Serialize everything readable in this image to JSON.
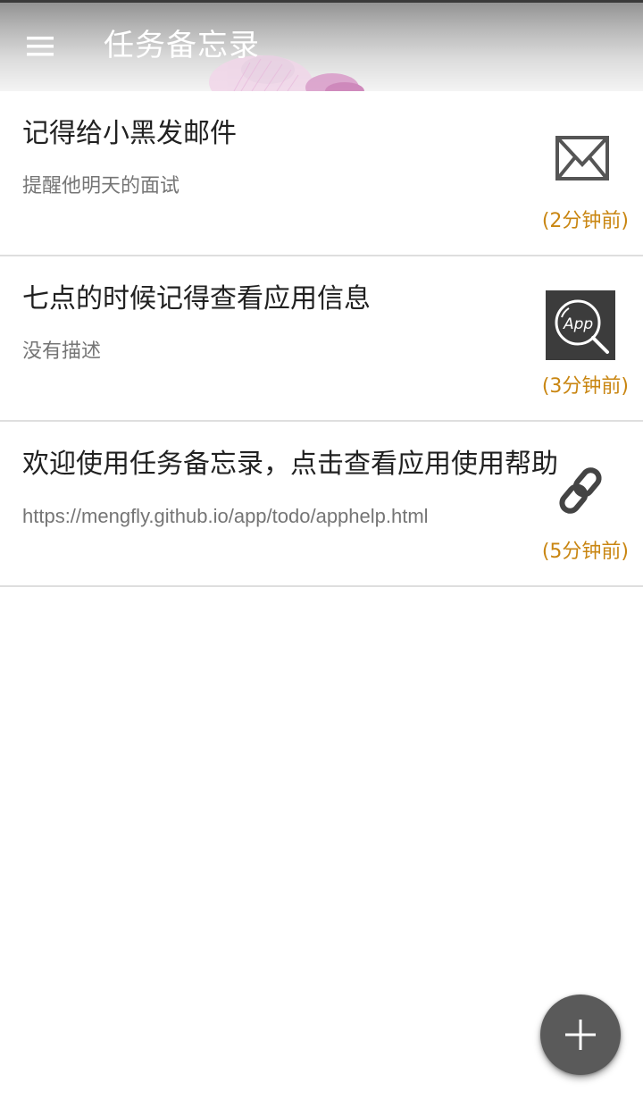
{
  "toolbar": {
    "title": "任务备忘录",
    "menu_icon": "menu-icon"
  },
  "tasks": [
    {
      "title": "记得给小黑发邮件",
      "description": "提醒他明天的面试",
      "time": "(2分钟前)",
      "icon": "mail-icon"
    },
    {
      "title": "七点的时候记得查看应用信息",
      "description": "没有描述",
      "time": "(3分钟前)",
      "icon": "app-search-icon",
      "icon_text": "App"
    },
    {
      "title": "欢迎使用任务备忘录，点击查看应用使用帮助",
      "description": "https://mengfly.github.io/app/todo/apphelp.html",
      "time": "(5分钟前)",
      "icon": "link-icon"
    }
  ],
  "fab": {
    "icon": "plus-icon"
  },
  "colors": {
    "time_text": "#c98612",
    "fab_background": "#5a5a5a",
    "title_text": "#212121",
    "description_text": "#757575"
  }
}
